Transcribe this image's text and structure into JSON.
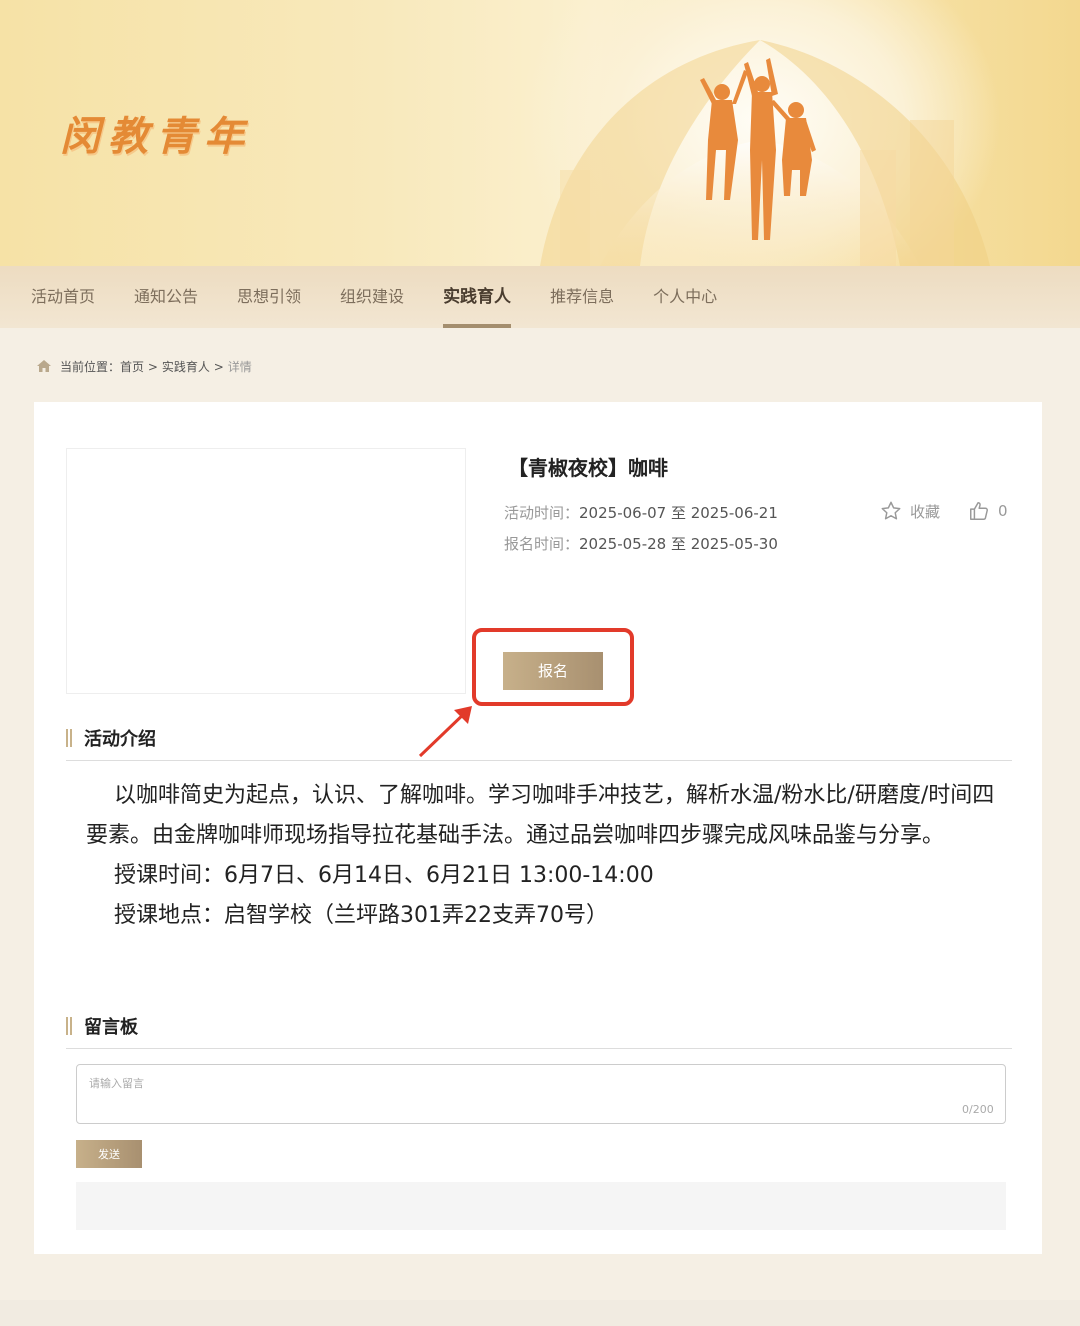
{
  "header": {
    "logo_text": "闵教青年"
  },
  "nav": {
    "items": [
      {
        "label": "活动首页"
      },
      {
        "label": "通知公告"
      },
      {
        "label": "思想引领"
      },
      {
        "label": "组织建设"
      },
      {
        "label": "实践育人",
        "active": true
      },
      {
        "label": "推荐信息"
      },
      {
        "label": "个人中心"
      }
    ]
  },
  "breadcrumb": {
    "prefix": "当前位置：",
    "items": [
      "首页 >",
      "实践育人 >"
    ],
    "current": "详情"
  },
  "activity": {
    "title": "【青椒夜校】咖啡",
    "activity_time_label": "活动时间：",
    "activity_time_value": "2025-06-07 至 2025-06-21",
    "signup_time_label": "报名时间：",
    "signup_time_value": "2025-05-28 至 2025-05-30",
    "favorite_label": "收藏",
    "like_count": "0",
    "signup_button": "报名"
  },
  "intro": {
    "heading": "活动介绍",
    "paragraph": "以咖啡简史为起点，认识、了解咖啡。学习咖啡手冲技艺，解析水温/粉水比/研磨度/时间四要素。由金牌咖啡师现场指导拉花基础手法。通过品尝咖啡四步骤完成风味品鉴与分享。",
    "class_time": "授课时间：6月7日、6月14日、6月21日   13:00-14:00",
    "class_location": "授课地点：启智学校（兰坪路301弄22支弄70号）"
  },
  "board": {
    "heading": "留言板",
    "placeholder": "请输入留言",
    "counter": "0/200",
    "send_button": "发送"
  },
  "colors": {
    "accent_gold": "#b39a75",
    "highlight_red": "#e23a2a",
    "logo_orange": "#e48a35"
  }
}
